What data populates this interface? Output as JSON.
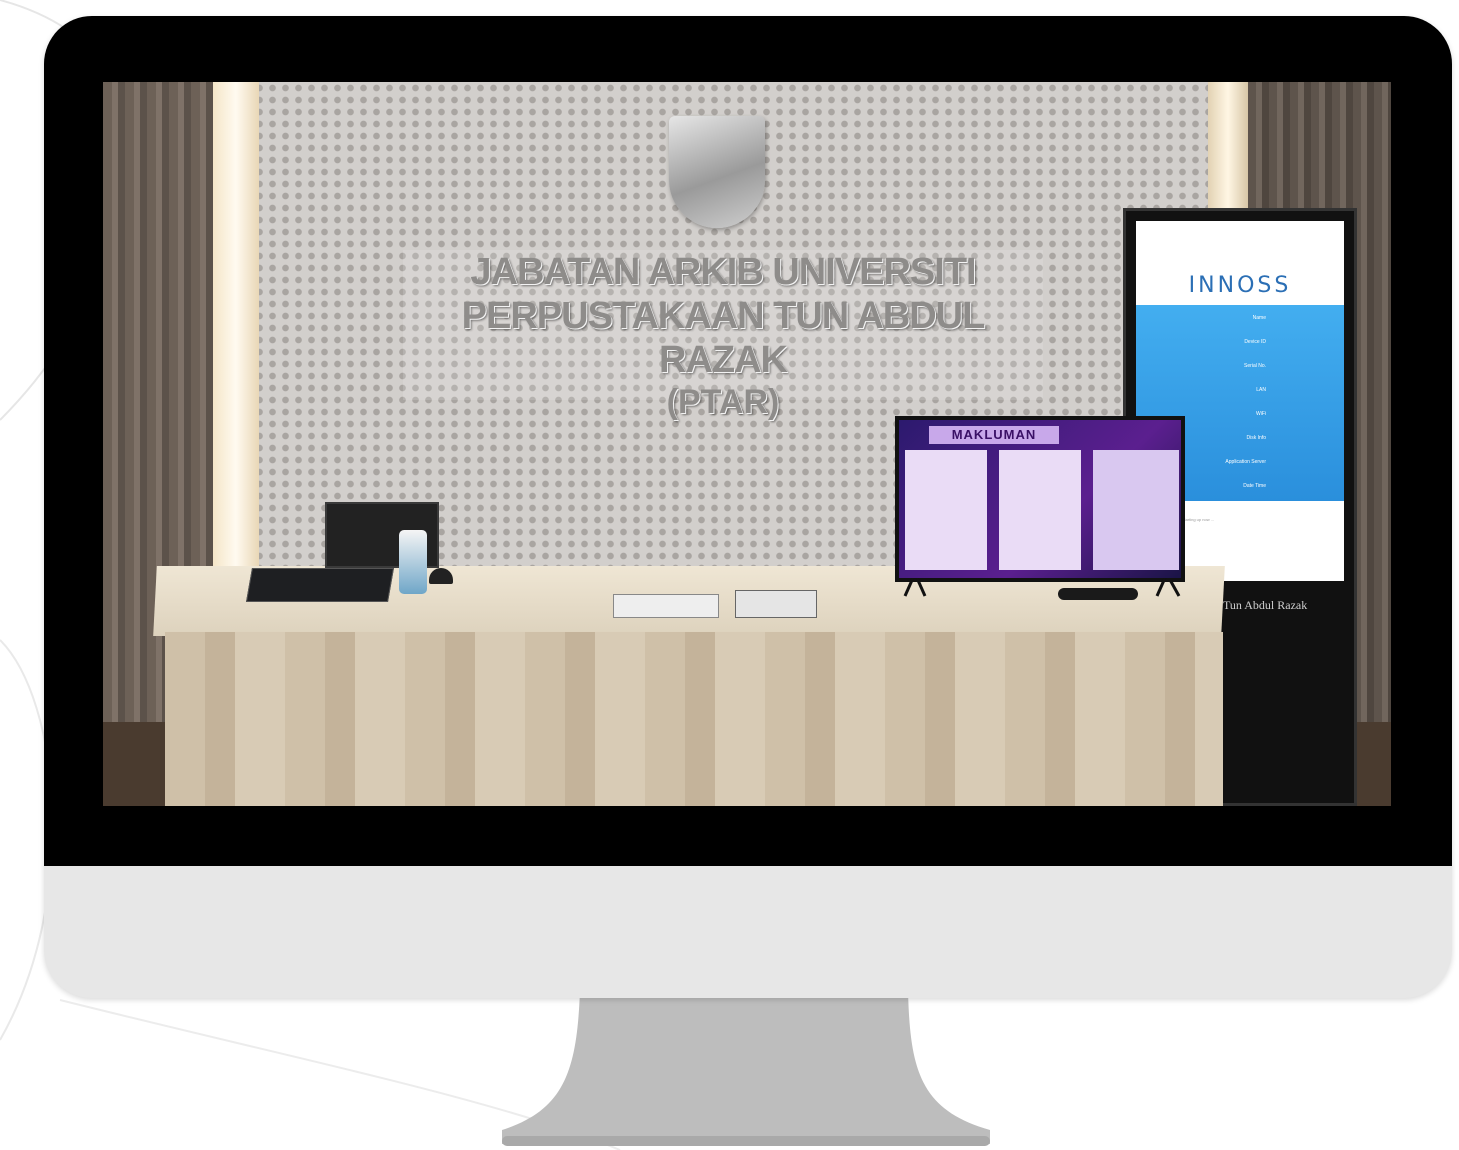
{
  "wall_sign": {
    "line1": "JABATAN ARKIB UNIVERSITI",
    "line2": "PERPUSTAKAAN TUN ABDUL RAZAK",
    "line3": "(PTAR)"
  },
  "tv_display": {
    "title": "MAKLUMAN"
  },
  "kiosk": {
    "brand": "INNOSS",
    "rows": [
      "Name",
      "Device ID",
      "Serial No.",
      "LAN",
      "WiFi",
      "Disk Info",
      "Application Server",
      "Date Time"
    ],
    "footer": "Please wait, system is starting up now ...",
    "stand_label": "Tun Abdul Razak"
  },
  "colors": {
    "bezel": "#000000",
    "chin": "#e7e7e7",
    "stand": "#bdbdbd",
    "kiosk_blue": "#3aa3ea",
    "tv_purple": "#5b1f8f"
  }
}
